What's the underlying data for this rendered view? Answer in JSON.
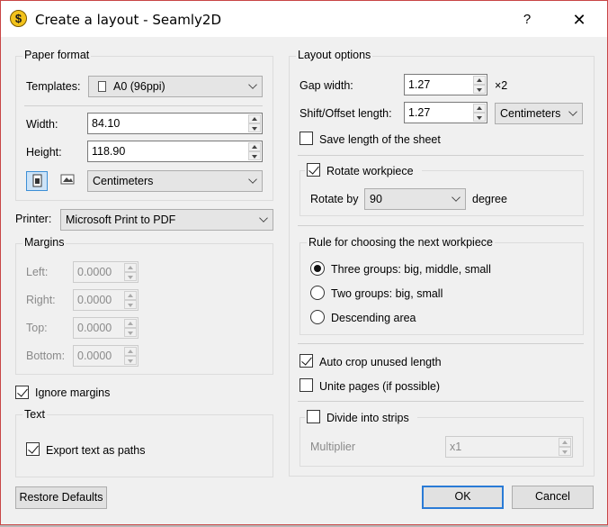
{
  "window": {
    "title": "Create a layout - Seamly2D",
    "help_label": "?",
    "close_label": "✕",
    "app_icon": "seamly-app-icon"
  },
  "paper_format": {
    "title": "Paper format",
    "templates_label": "Templates:",
    "template_value": "A0 (96ppi)",
    "width_label": "Width:",
    "width_value": "84.10",
    "height_label": "Height:",
    "height_value": "118.90",
    "units_value": "Centimeters"
  },
  "printer": {
    "label": "Printer:",
    "value": "Microsoft Print to PDF"
  },
  "margins": {
    "title": "Margins",
    "left_label": "Left:",
    "left_value": "0.0000",
    "right_label": "Right:",
    "right_value": "0.0000",
    "top_label": "Top:",
    "top_value": "0.0000",
    "bottom_label": "Bottom:",
    "bottom_value": "0.0000"
  },
  "ignore_margins": {
    "label": "Ignore margins",
    "checked": true
  },
  "text_group": {
    "title": "Text",
    "export_text_label": "Export text as paths",
    "checked": true
  },
  "layout_options": {
    "title": "Layout options",
    "gap_width_label": "Gap width:",
    "gap_width_value": "1.27",
    "gap_multiplier": "×2",
    "shift_label": "Shift/Offset length:",
    "shift_value": "1.27",
    "shift_units": "Centimeters",
    "save_length_label": "Save length of the sheet",
    "rotate_label": "Rotate workpiece",
    "rotate_by_label": "Rotate by",
    "rotate_by_value": "90",
    "degree_label": "degree",
    "rule_title": "Rule for choosing the next workpiece",
    "rule_options": [
      "Three groups: big, middle, small",
      "Two groups: big, small",
      "Descending area"
    ],
    "auto_crop_label": "Auto crop unused length",
    "unite_pages_label": "Unite pages (if possible)",
    "divide_strips_label": "Divide into strips",
    "multiplier_label": "Multiplier",
    "multiplier_value": "x1"
  },
  "buttons": {
    "restore_defaults": "Restore Defaults",
    "ok": "OK",
    "cancel": "Cancel"
  }
}
